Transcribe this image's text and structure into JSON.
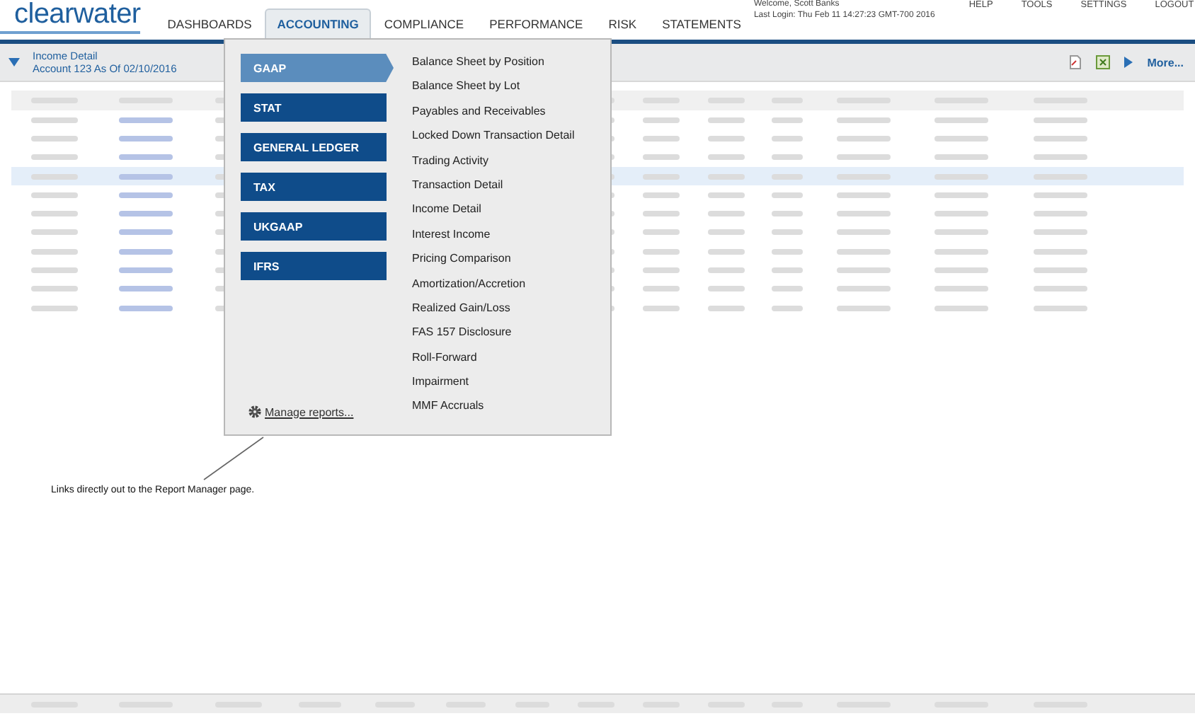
{
  "logo": "clearwater",
  "nav": [
    {
      "label": "DASHBOARDS",
      "selected": false
    },
    {
      "label": "ACCOUNTING",
      "selected": true
    },
    {
      "label": "COMPLIANCE",
      "selected": false
    },
    {
      "label": "PERFORMANCE",
      "selected": false
    },
    {
      "label": "RISK",
      "selected": false
    },
    {
      "label": "STATEMENTS",
      "selected": false
    }
  ],
  "user": {
    "welcome": "Welcome, Scott Banks",
    "last_login": "Last Login: Thu Feb 11 14:27:23 GMT-700 2016"
  },
  "top_links": [
    "HELP",
    "TOOLS",
    "SETTINGS",
    "LOGOUT"
  ],
  "report_bar": {
    "title": "Income Detail",
    "subtitle": "Account 123 As Of 02/10/2016",
    "more": "More..."
  },
  "menu": {
    "categories": [
      {
        "label": "GAAP",
        "selected": true
      },
      {
        "label": "STAT",
        "selected": false
      },
      {
        "label": "GENERAL LEDGER",
        "selected": false
      },
      {
        "label": "TAX",
        "selected": false
      },
      {
        "label": "UKGAAP",
        "selected": false
      },
      {
        "label": "IFRS",
        "selected": false
      }
    ],
    "reports": [
      "Balance Sheet by Position",
      "Balance Sheet by Lot",
      "Payables and Receivables",
      "Locked Down Transaction Detail",
      "Trading Activity",
      "Transaction Detail",
      "Income Detail",
      "Interest Income",
      "Pricing Comparison",
      "Amortization/Accretion",
      "Realized Gain/Loss",
      "FAS 157 Disclosure",
      "Roll-Forward",
      "Impairment",
      "MMF Accruals"
    ],
    "manage": "Manage reports..."
  },
  "callout": "Links directly out to the Report Manager page."
}
